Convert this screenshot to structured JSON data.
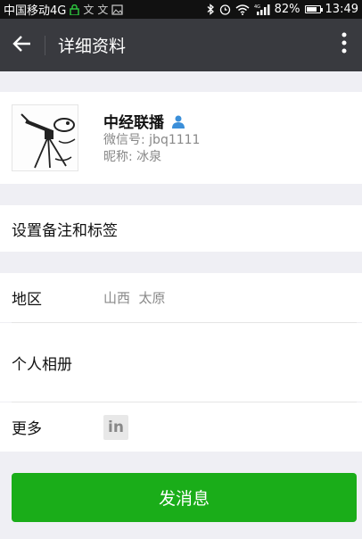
{
  "status_bar": {
    "carrier": "中国移动4G",
    "battery_percent": "82%",
    "battery_level": 0.82,
    "time": "13:49",
    "icons": [
      "lock-icon",
      "app-notification-icon",
      "app-notification-icon",
      "image-icon",
      "bluetooth-icon",
      "alarm-icon",
      "wifi-icon",
      "signal-4g-icon",
      "battery-icon"
    ]
  },
  "header": {
    "title": "详细资料",
    "back_icon": "arrow-left-icon",
    "more_icon": "more-vertical-icon"
  },
  "profile": {
    "name": "中经联播",
    "wechat_id": "微信号: jbq1111",
    "nickname": "昵称: 冰泉",
    "badge_icon": "contact-person-icon",
    "badge_color": "#3b8fd9"
  },
  "rows": {
    "remark_label": "设置备注和标签",
    "region_label": "地区",
    "region_value": "山西  太原",
    "album_label": "个人相册",
    "more_label": "更多",
    "more_icon": "linkedin-icon",
    "more_icon_text": "in"
  },
  "actions": {
    "send_message": "发消息",
    "send_color": "#1aad19"
  }
}
